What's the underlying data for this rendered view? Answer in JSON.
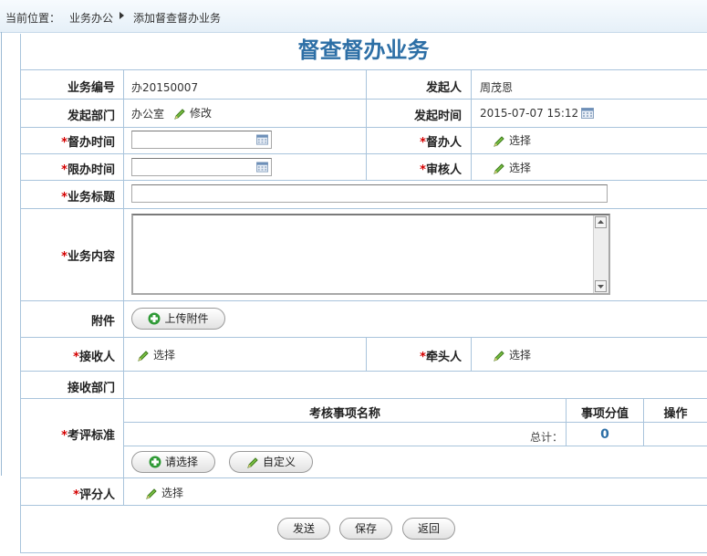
{
  "breadcrumb": {
    "prefix": "当前位置：",
    "level1": "业务办公",
    "level2": "添加督查督办业务"
  },
  "form": {
    "title": "督查督办业务",
    "required_mark": "*",
    "business_no_label": "业务编号",
    "business_no_value": "办20150007",
    "initiator_label": "发起人",
    "initiator_value": "周茂恩",
    "dept_label": "发起部门",
    "dept_value": "办公室",
    "dept_edit": "修改",
    "init_time_label": "发起时间",
    "init_time_value": "2015-07-07 15:12",
    "supervise_time_label": "督办时间",
    "supervisor_label": "督办人",
    "limit_time_label": "限办时间",
    "reviewer_label": "审核人",
    "subject_label": "业务标题",
    "content_label": "业务内容",
    "attachment_label": "附件",
    "upload_button": "上传附件",
    "receiver_label": "接收人",
    "leader_label": "牵头人",
    "receive_dept_label": "接收部门",
    "criteria_label": "考评标准",
    "scorer_label": "评分人",
    "select_text": "选择"
  },
  "criteria_table": {
    "headers": [
      "考核事项名称",
      "事项分值",
      "操作"
    ],
    "total_label": "总计：",
    "total_value": "0",
    "choose_button": "请选择",
    "custom_button": "自定义"
  },
  "actions": {
    "send": "发送",
    "save": "保存",
    "back": "返回"
  },
  "colors": {
    "title": "#2d6fa6",
    "border": "#a9c4dc",
    "required": "#d40000"
  }
}
